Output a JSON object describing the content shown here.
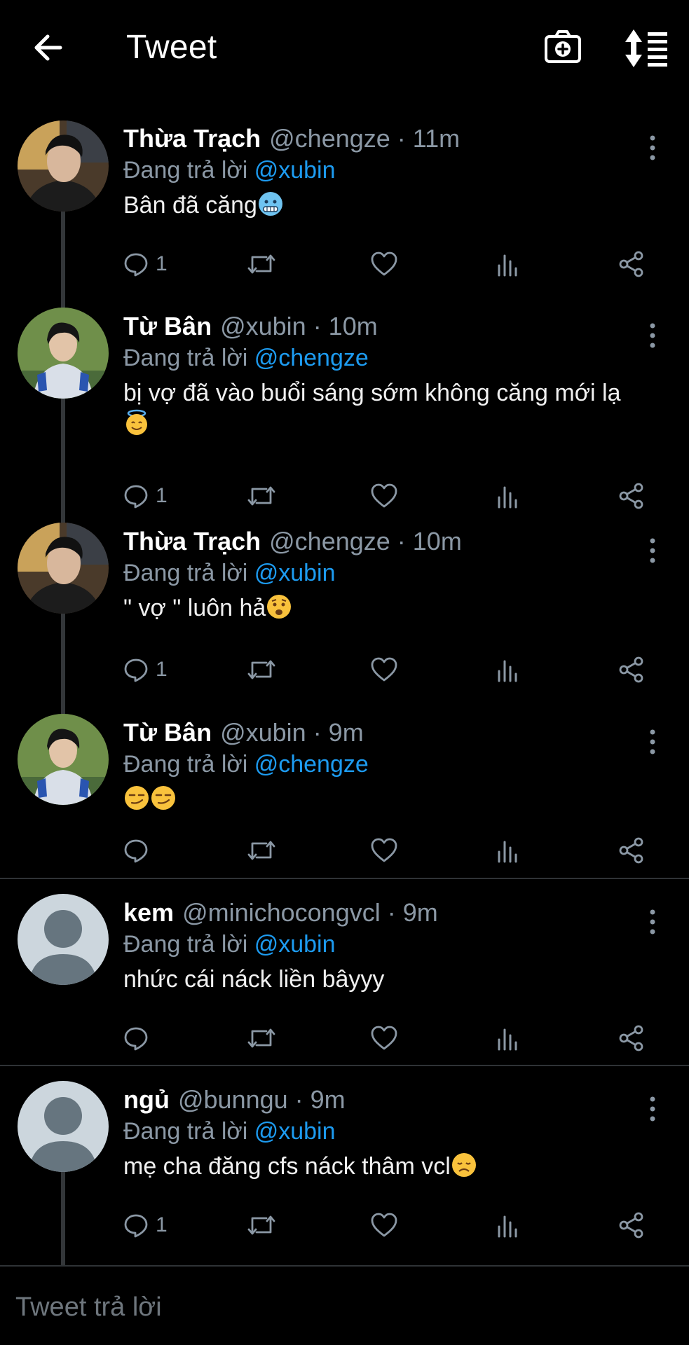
{
  "header": {
    "title": "Tweet"
  },
  "tweets": [
    {
      "name": "Thừa Trạch",
      "handle": "@chengze · 11m",
      "replying_prefix": "Đang trả lời",
      "mention": "@xubin",
      "text": "Bân đã căng",
      "emoji": "freezing-face",
      "reply_count": "1"
    },
    {
      "name": "Từ Bân",
      "handle": "@xubin · 10m",
      "replying_prefix": "Đang trả lời",
      "mention": "@chengze",
      "text": "bị vợ đã vào buổi sáng sớm không căng mới lạ",
      "emoji": "halo-face",
      "reply_count": "1"
    },
    {
      "name": "Thừa Trạch",
      "handle": "@chengze · 10m",
      "replying_prefix": "Đang trả lời",
      "mention": "@xubin",
      "text": "\" vợ \" luôn hả",
      "emoji": "worried-face",
      "reply_count": "1"
    },
    {
      "name": "Từ Bân",
      "handle": "@xubin · 9m",
      "replying_prefix": "Đang trả lời",
      "mention": "@chengze",
      "text": "",
      "emoji": "smirk-face-x2",
      "reply_count": ""
    },
    {
      "name": "kem",
      "handle": "@minichocongvcl · 9m",
      "replying_prefix": "Đang trả lời",
      "mention": "@xubin",
      "text": "nhức cái náck liền bâyyy",
      "emoji": "",
      "reply_count": ""
    },
    {
      "name": "ngủ",
      "handle": "@bunngu · 9m",
      "replying_prefix": "Đang trả lời",
      "mention": "@xubin",
      "text": "mẹ cha đăng cfs náck thâm vcl",
      "emoji": "disappointed-face",
      "reply_count": "1"
    }
  ],
  "reply_box": {
    "placeholder": "Tweet trả lời"
  },
  "colors": {
    "background": "#000000",
    "mention": "#1d9bf0",
    "secondary_text": "#8b98a5",
    "divider": "#2f3336"
  }
}
